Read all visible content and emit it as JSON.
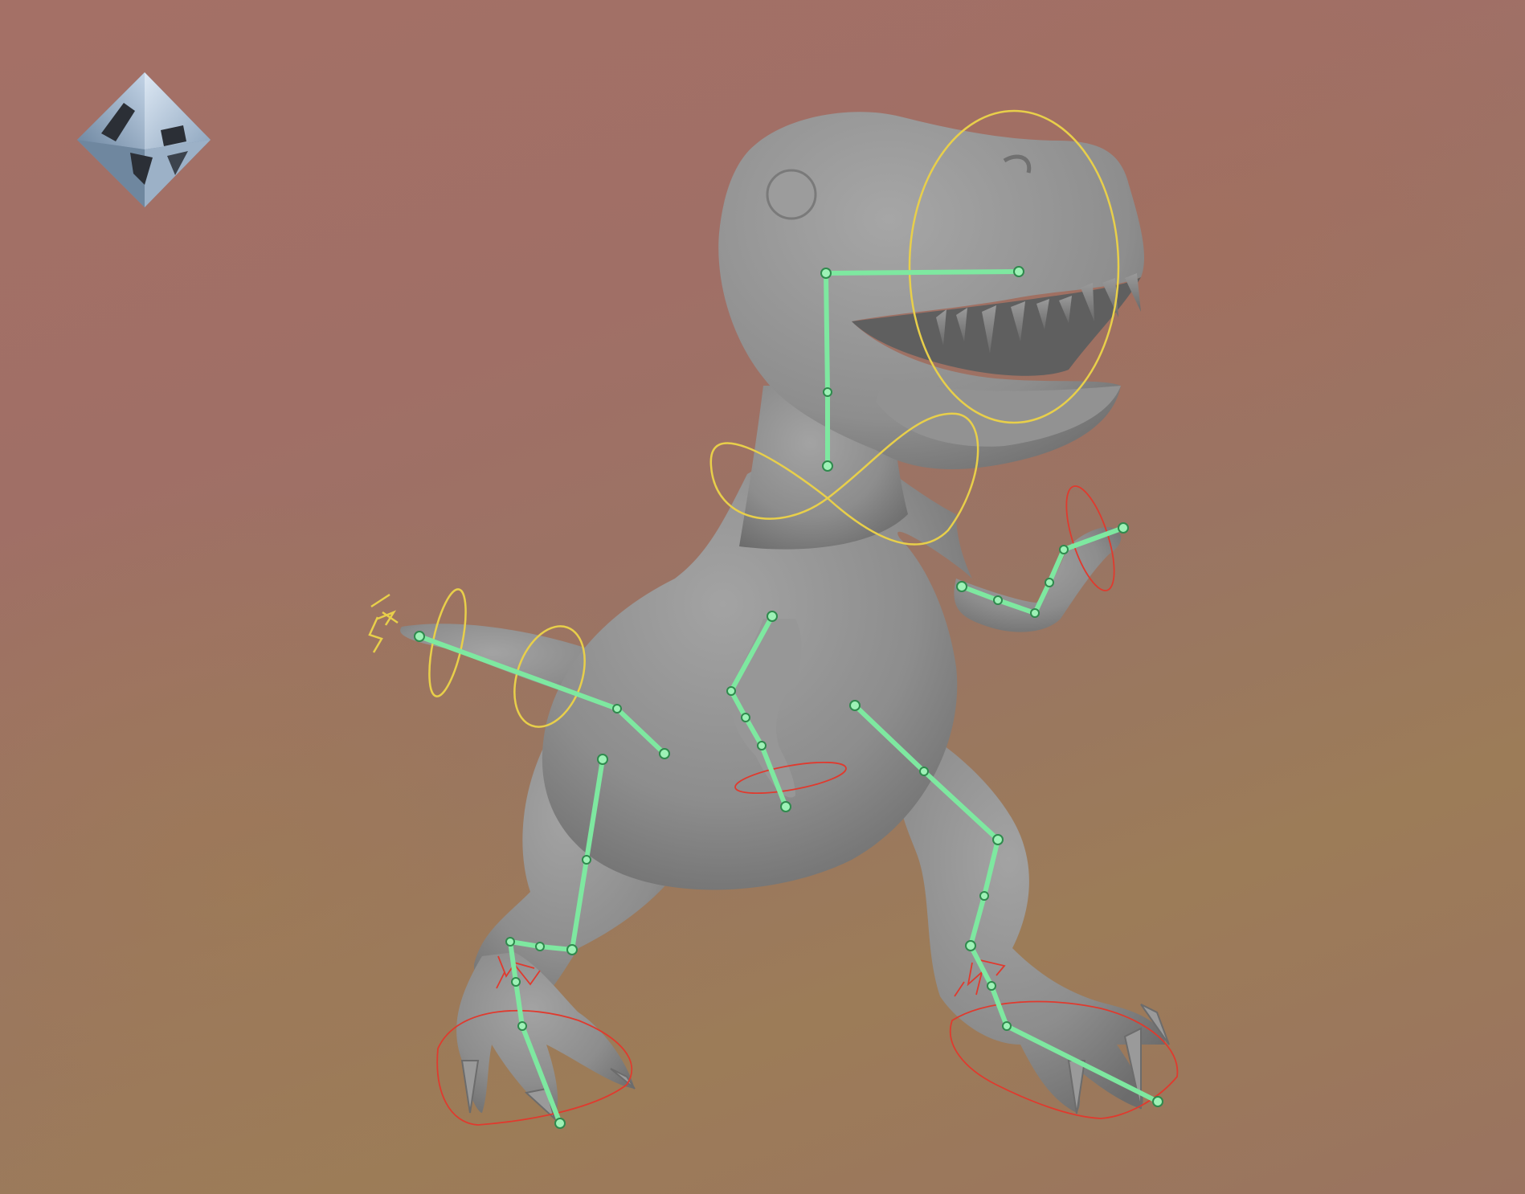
{
  "viewport": {
    "background_top": "#a47066",
    "background_bottom": "#9c7c58"
  },
  "view_cube": {
    "icon": "view-cube-icon"
  },
  "model": {
    "mesh_color": "#8f8f8f",
    "joint_color": "#7ee8a0",
    "control_fk_color": "#e8cf4a",
    "control_ik_color": "#e03a2e"
  }
}
